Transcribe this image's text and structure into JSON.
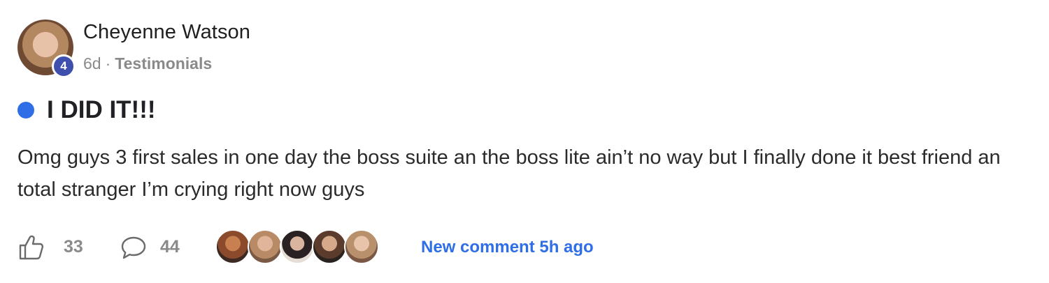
{
  "post": {
    "author": {
      "name": "Cheyenne Watson",
      "level": "4"
    },
    "meta": {
      "time_ago": "6d",
      "separator": "·",
      "category": "Testimonials"
    },
    "title": "I DID IT!!!",
    "body": "Omg guys 3 first sales in one day the boss suite an the boss lite ain’t no way but I finally done it best friend an total stranger I’m crying right now guys",
    "stats": {
      "likes": "33",
      "comments": "44"
    },
    "new_comment_label": "New comment 5h ago"
  },
  "colors": {
    "accent": "#2f6ee6",
    "level_badge": "#3f4fae",
    "muted_text": "#8a8a8a"
  },
  "icons": {
    "like": "thumbs-up-icon",
    "comment": "speech-bubble-icon",
    "unread": "unread-dot-icon"
  }
}
